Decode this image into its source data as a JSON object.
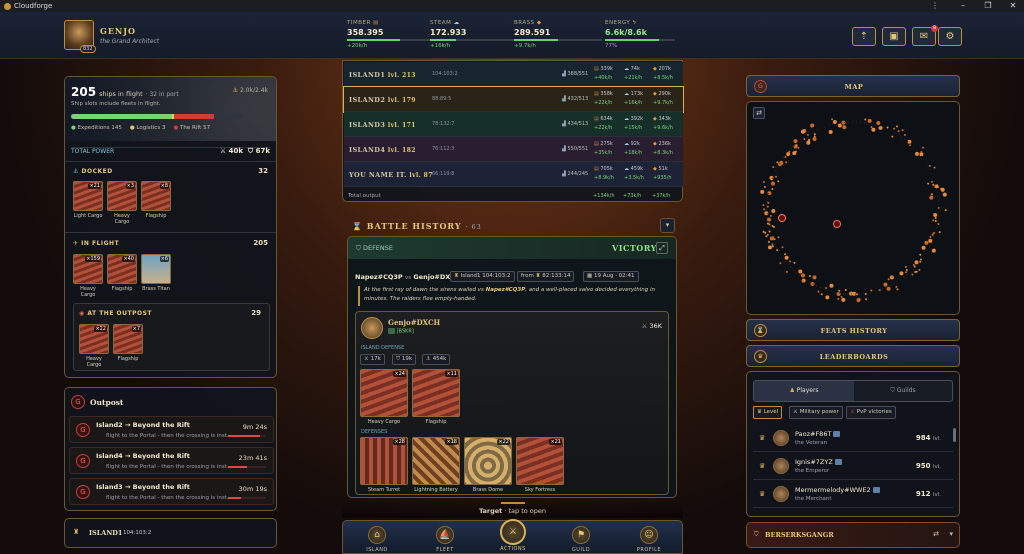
{
  "window": {
    "title": "Cloudforge",
    "controls": [
      "⋮",
      "–",
      "❐",
      "✕"
    ]
  },
  "player": {
    "name": "Genjo",
    "title": "the Grand Architect",
    "level": "832"
  },
  "resources": [
    {
      "label": "TIMBER",
      "value": "358.395",
      "rate": "+20k/h",
      "fill": 0.6
    },
    {
      "label": "STEAM",
      "value": "172.933",
      "rate": "+16k/h",
      "fill": 0.3
    },
    {
      "label": "BRASS",
      "value": "289.591",
      "rate": "+9.7k/h",
      "fill": 0.5
    },
    {
      "label": "ENERGY",
      "value": "6.6k/8.6k",
      "rate": "77%",
      "fill": 0.77
    }
  ],
  "header_buttons": [
    {
      "icon": "boost-icon",
      "glyph": "⇡"
    },
    {
      "icon": "chest-icon",
      "glyph": "▣"
    },
    {
      "icon": "mail-icon",
      "glyph": "✉",
      "badge": "8"
    },
    {
      "icon": "gear-icon",
      "glyph": "⚙"
    }
  ],
  "fleet": {
    "ships": "205",
    "ships_suffix": "ships in flight",
    "port": "· 32 in port",
    "capacity": "2.0k/2.4k",
    "note": "Ship slots include fleets in flight.",
    "legend": [
      {
        "label": "Expeditions 145",
        "color": "#79d27a"
      },
      {
        "label": "Logistics 3",
        "color": "#e6c77a"
      },
      {
        "label": "The Rift 57",
        "color": "#d23b3b"
      }
    ],
    "bar": {
      "expeditions": 0.59,
      "logistics": 0.01,
      "rift": 0.23
    },
    "total_power_label": "TOTAL POWER",
    "attack": "40k",
    "defense": "67k",
    "docked": {
      "label": "DOCKED",
      "count": "32",
      "ships": [
        {
          "name": "Light Cargo",
          "count": "×21"
        },
        {
          "name": "Heavy Cargo",
          "count": "×3"
        },
        {
          "name": "Flagship",
          "count": "×8"
        }
      ]
    },
    "in_flight": {
      "label": "IN FLIGHT",
      "count": "205",
      "ships": [
        {
          "name": "Heavy Cargo",
          "count": "×159"
        },
        {
          "name": "Flagship",
          "count": "×40"
        },
        {
          "name": "Brass Titan",
          "count": "×6"
        }
      ]
    },
    "outpost": {
      "label": "AT THE OUTPOST",
      "count": "29",
      "ships": [
        {
          "name": "Heavy Cargo",
          "count": "×22"
        },
        {
          "name": "Flagship",
          "count": "×7"
        }
      ]
    }
  },
  "outpost_panel": {
    "title": "Outpost",
    "items": [
      {
        "title": "Island2 → Beyond the Rift",
        "subtitle": "flight to the Portal - then the crossing is inst...",
        "time": "9m 24s",
        "progress": 0.85
      },
      {
        "title": "Island4 → Beyond the Rift",
        "subtitle": "flight to the Portal - then the crossing is inst...",
        "time": "23m 41s",
        "progress": 0.5
      },
      {
        "title": "Island3 → Beyond the Rift",
        "subtitle": "flight to the Portal - then the crossing is inst...",
        "time": "30m 19s",
        "progress": 0.35
      }
    ],
    "island_footer": {
      "name": "ISLAND1",
      "coords": "104:103:2"
    }
  },
  "islands": [
    {
      "name": "Island1",
      "level": "lvl. 213",
      "coords": "104:103:2",
      "capacity": "388/551",
      "timber": "339k",
      "timber_rate": "+40k/h",
      "steam": "74k",
      "steam_rate": "+21k/h",
      "brass": "207k",
      "brass_rate": "+8.5k/h",
      "bg": "#17252f",
      "border": ""
    },
    {
      "name": "Island2",
      "level": "lvl. 179",
      "coords": "88:89:5",
      "capacity": "432/513",
      "timber": "358k",
      "timber_rate": "+22k/h",
      "steam": "173k",
      "steam_rate": "+16k/h",
      "brass": "290k",
      "brass_rate": "+9.7k/h",
      "bg": "#2a2418",
      "border": "#d8b15a"
    },
    {
      "name": "Island3",
      "level": "lvl. 171",
      "coords": "78:132:7",
      "capacity": "434/513",
      "timber": "634k",
      "timber_rate": "+22k/h",
      "steam": "392k",
      "steam_rate": "+15k/h",
      "brass": "343k",
      "brass_rate": "+9.6k/h",
      "bg": "#163029",
      "border": ""
    },
    {
      "name": "Island4",
      "level": "lvl. 182",
      "coords": "76:112:3",
      "capacity": "550/551",
      "timber": "275k",
      "timber_rate": "+35k/h",
      "steam": "92k",
      "steam_rate": "+18k/h",
      "brass": "236k",
      "brass_rate": "+8.3k/h",
      "bg": "#291d30",
      "border": ""
    },
    {
      "name": "You name it.",
      "level": "lvl. 87",
      "coords": "66:119:8",
      "capacity": "244/245",
      "timber": "705k",
      "timber_rate": "+8.9k/h",
      "steam": "459k",
      "steam_rate": "+3.5k/h",
      "brass": "51k",
      "brass_rate": "+935/h",
      "bg": "#1d2236",
      "border": ""
    }
  ],
  "islands_total": {
    "label": "Total output",
    "timber": "+134k/h",
    "steam": "+73k/h",
    "brass": "+37k/h"
  },
  "battle": {
    "title": "BATTLE HISTORY",
    "count": "· 63",
    "type": "DEFENSE",
    "result": "VICTORY",
    "attacker": "Napez#CQ3P",
    "vs": "vs",
    "defender_name": "Genjo#DXCH",
    "location": "Island1 104:103:2",
    "from_label": "from",
    "from": "82:133:14",
    "date": "19 Aug · 02:41",
    "story_pre": "At the first ray of dawn the sirens wailed vs ",
    "story_name": "Napez#CQ3P",
    "story_post": ", and a well-placed salvo decided everything in minutes. The raiders flee empty-handed.",
    "card": {
      "name": "Genjo#DXCH",
      "tag": "[BSKR]",
      "power": "36K",
      "island_defense_label": "ISLAND DEFENSE",
      "stats": [
        "17k",
        "19k",
        "454k"
      ],
      "ships": [
        {
          "name": "Heavy Cargo",
          "count": "×24"
        },
        {
          "name": "Flagship",
          "count": "×11"
        }
      ],
      "defenses_label": "DEFENSES",
      "defenses": [
        {
          "name": "Steam Turret",
          "count": "×28"
        },
        {
          "name": "Lightning Battery",
          "count": "×18"
        },
        {
          "name": "Brass Dome",
          "count": "×22"
        },
        {
          "name": "Sky Fortress",
          "count": "×21"
        }
      ]
    }
  },
  "target_hint": {
    "label": "Target",
    "suffix": " · tap to open"
  },
  "nav": [
    {
      "label": "ISLAND",
      "icon": "island-icon",
      "glyph": "⌂",
      "active": false
    },
    {
      "label": "FLEET",
      "icon": "fleet-icon",
      "glyph": "⛵",
      "active": false
    },
    {
      "label": "ACTIONS",
      "icon": "actions-icon",
      "glyph": "⚔",
      "active": true
    },
    {
      "label": "GUILD",
      "icon": "guild-icon",
      "glyph": "⚑",
      "active": false
    },
    {
      "label": "PROFILE",
      "icon": "profile-icon",
      "glyph": "☺",
      "active": false
    }
  ],
  "right": {
    "map_label": "MAP",
    "feats_label": "FEATS HISTORY",
    "leaderboards_label": "LEADERBOARDS",
    "tabs": [
      "Players",
      "Guilds"
    ],
    "filters": [
      "Level",
      "Military power",
      "PvP victories"
    ],
    "players": [
      {
        "name": "Paoz#F86T",
        "title": "the Veteran",
        "level": "984"
      },
      {
        "name": "Ignis#7ZYZ",
        "title": "the Emperor",
        "level": "950"
      },
      {
        "name": "Mermermelody#WWE2",
        "title": "the Merchant",
        "level": "912"
      }
    ],
    "level_suffix": "lvl.",
    "guild_label": "BERSERKSGANGR"
  }
}
